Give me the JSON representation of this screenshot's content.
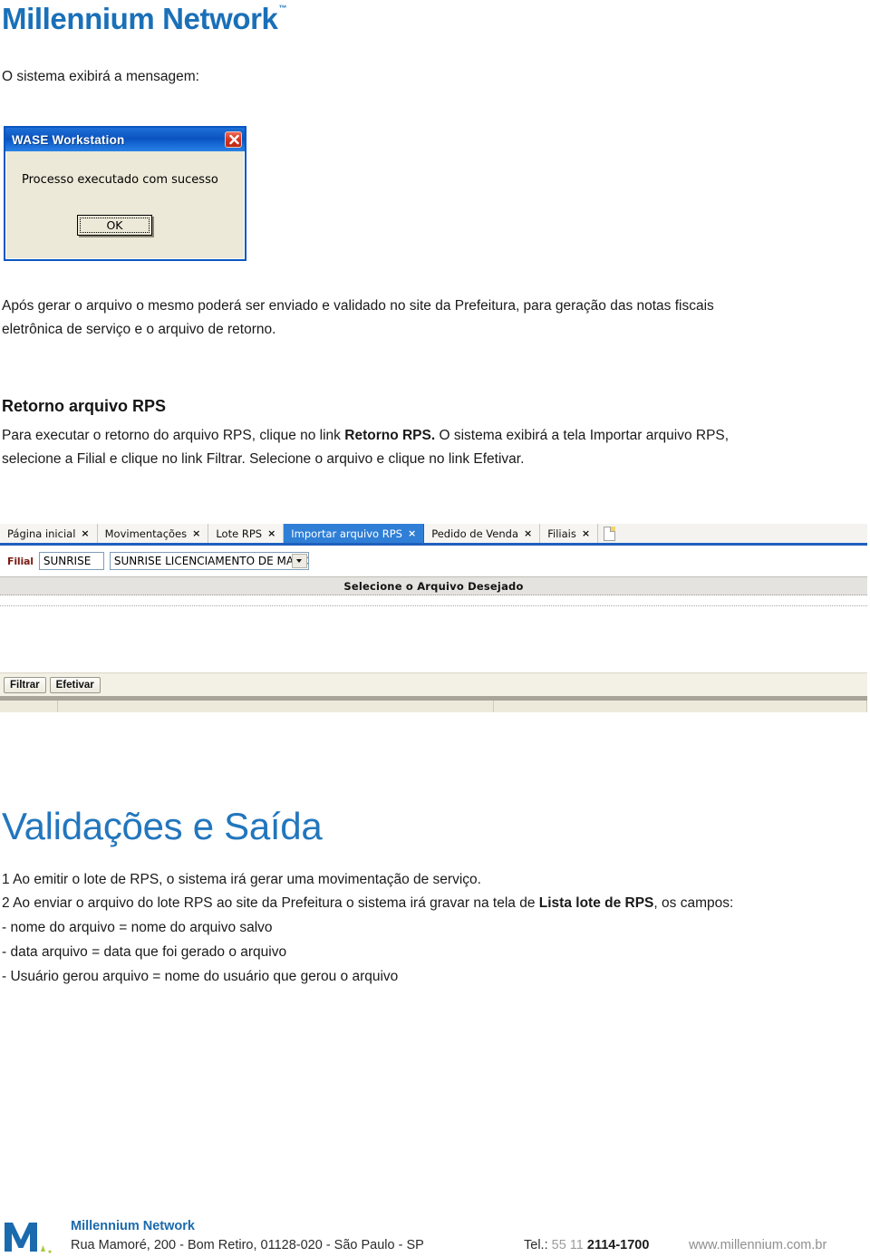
{
  "header": {
    "title": "Millennium Network",
    "trademark": "™",
    "brand_color": "#1a70b8"
  },
  "intro": {
    "text": "O sistema exibirá a mensagem:"
  },
  "dialog": {
    "title": "WASE Workstation",
    "message": "Processo executado com sucesso",
    "ok_label": "OK",
    "close_icon": "close-icon"
  },
  "paragraph1": {
    "line1": "Após gerar o arquivo o mesmo poderá ser enviado e validado no site da Prefeitura, para geração das notas fiscais",
    "line2": "eletrônica de serviço e o arquivo de retorno."
  },
  "section_retorno": {
    "heading": "Retorno arquivo RPS",
    "line1_a": "Para executar o retorno do arquivo RPS, clique no link ",
    "line1_b": "Retorno RPS.",
    "line1_c": " O sistema exibirá a tela Importar arquivo RPS,",
    "line2": "selecione a Filial e clique no link Filtrar. Selecione o arquivo e clique no link Efetivar."
  },
  "app_screenshot": {
    "tabs": [
      {
        "label": "Página inicial",
        "active": false,
        "close": "×"
      },
      {
        "label": "Movimentações",
        "active": false,
        "close": "×"
      },
      {
        "label": "Lote RPS",
        "active": false,
        "close": "×"
      },
      {
        "label": "Importar arquivo RPS",
        "active": true,
        "close": "×"
      },
      {
        "label": "Pedido de Venda",
        "active": false,
        "close": "×"
      },
      {
        "label": "Filiais",
        "active": false,
        "close": "×"
      }
    ],
    "new_tab_icon": "new-document-icon",
    "filial_label": "Filial",
    "filial_code": "SUNRISE",
    "filial_name": "SUNRISE LICENCIAMENTO DE MARCAS LTDA",
    "combo_icon": "chevron-down-icon",
    "grid_header": "Selecione o Arquivo Desejado",
    "buttons": [
      {
        "label": "Filtrar"
      },
      {
        "label": "Efetivar"
      }
    ],
    "active_tab_color": "#2f7fd6",
    "filial_label_color": "#7b1d14"
  },
  "section_validacoes": {
    "heading": "Validações e Saída",
    "item1": "1 Ao emitir o lote de RPS, o sistema irá gerar uma movimentação de serviço.",
    "item2_a": "2 Ao enviar o arquivo do lote RPS ao site da Prefeitura o sistema irá gravar na tela de ",
    "item2_b": "Lista lote de RPS",
    "item2_c": ", os campos:",
    "bullets": [
      "- nome do arquivo = nome do arquivo salvo",
      "- data arquivo = data que foi gerado o arquivo",
      "- Usuário gerou arquivo = nome do usuário que gerou o arquivo"
    ]
  },
  "footer": {
    "logo_icon": "millennium-m-logo",
    "company": "Millennium Network",
    "address": "Rua Mamoré, 200 - Bom Retiro, 01128-020 - São Paulo - SP",
    "tel_prefix": "Tel.: ",
    "tel_code": "55 11 ",
    "tel_number": "2114-1700",
    "website": "www.millennium.com.br"
  }
}
